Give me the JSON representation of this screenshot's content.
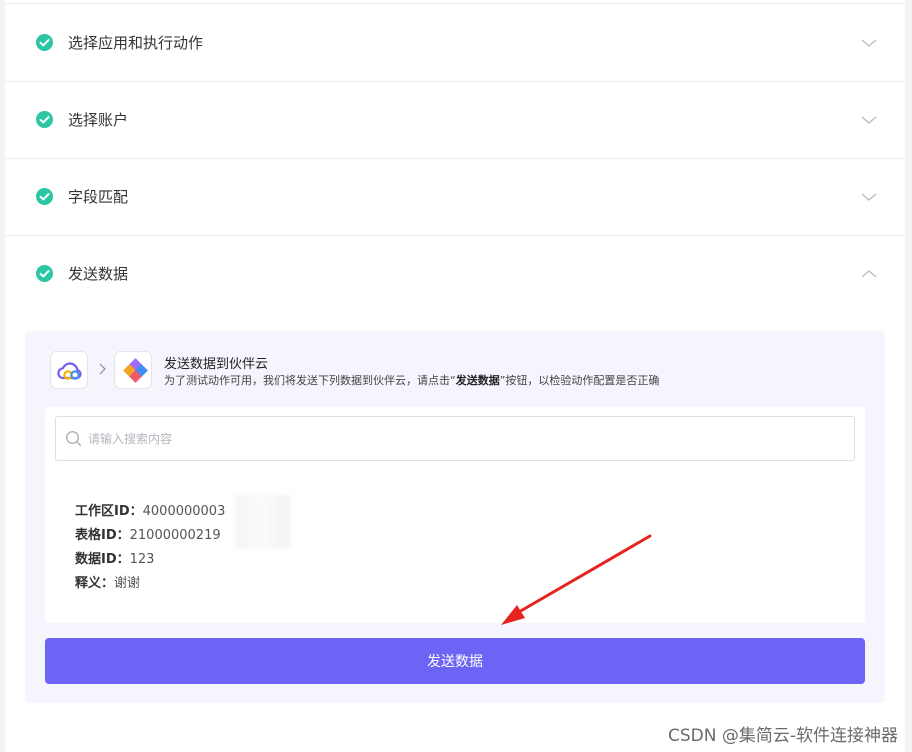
{
  "steps": [
    {
      "title": "选择应用和执行动作",
      "state": "completed"
    },
    {
      "title": "选择账户",
      "state": "completed"
    },
    {
      "title": "字段匹配",
      "state": "completed"
    },
    {
      "title": "发送数据",
      "state": "expanded"
    }
  ],
  "send": {
    "source_icon": "cloud-logo-icon",
    "target_icon": "diamond-app-icon",
    "title": "发送数据到伙伴云",
    "desc_prefix": "为了测试动作可用，我们将发送下列数据到伙伴云，请点击“",
    "desc_bold": "发送数据",
    "desc_suffix": "”按钮，以检验动作配置是否正确",
    "search_placeholder": "请输入搜索内容",
    "search_value": "",
    "fields": [
      {
        "label": "工作区ID：",
        "value": "4000000003"
      },
      {
        "label": "表格ID：",
        "value": "21000000219"
      },
      {
        "label": "数据ID：",
        "value": "123"
      },
      {
        "label": "释义：",
        "value": "谢谢"
      }
    ],
    "button_label": "发送数据"
  },
  "watermark": "CSDN @集简云-软件连接神器",
  "colors": {
    "accent": "#6d63f5",
    "check": "#2bc6a4",
    "annotation_arrow": "#e8231f"
  }
}
